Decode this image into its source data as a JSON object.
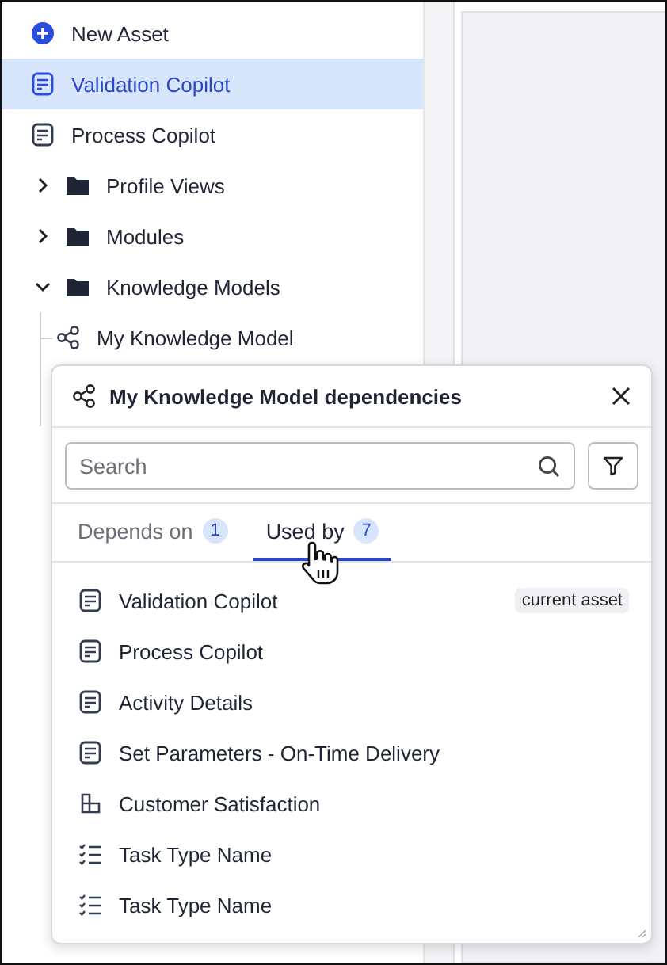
{
  "sidebar": {
    "items": [
      {
        "kind": "add",
        "label": "New Asset",
        "selected": false
      },
      {
        "kind": "asset",
        "label": "Validation Copilot",
        "selected": true
      },
      {
        "kind": "asset",
        "label": "Process Copilot",
        "selected": false
      },
      {
        "kind": "folder",
        "label": "Profile Views",
        "selected": false,
        "expanded": false
      },
      {
        "kind": "folder",
        "label": "Modules",
        "selected": false,
        "expanded": false
      },
      {
        "kind": "folder",
        "label": "Knowledge Models",
        "selected": false,
        "expanded": true,
        "children": [
          {
            "kind": "model",
            "label": "My Knowledge Model",
            "selected": false
          }
        ]
      }
    ]
  },
  "popover": {
    "title": "My Knowledge Model dependencies",
    "search": {
      "placeholder": "Search"
    },
    "tabs": [
      {
        "label": "Depends on",
        "count": "1",
        "selected": false
      },
      {
        "label": "Used by",
        "count": "7",
        "selected": true
      }
    ],
    "items": [
      {
        "kind": "asset",
        "label": "Validation Copilot",
        "badge": "current asset"
      },
      {
        "kind": "asset",
        "label": "Process Copilot"
      },
      {
        "kind": "asset",
        "label": "Activity Details"
      },
      {
        "kind": "asset",
        "label": "Set Parameters - On-Time Delivery"
      },
      {
        "kind": "grid",
        "label": "Customer Satisfaction"
      },
      {
        "kind": "tasks",
        "label": "Task Type Name"
      },
      {
        "kind": "tasks",
        "label": "Task Type Name"
      }
    ]
  }
}
